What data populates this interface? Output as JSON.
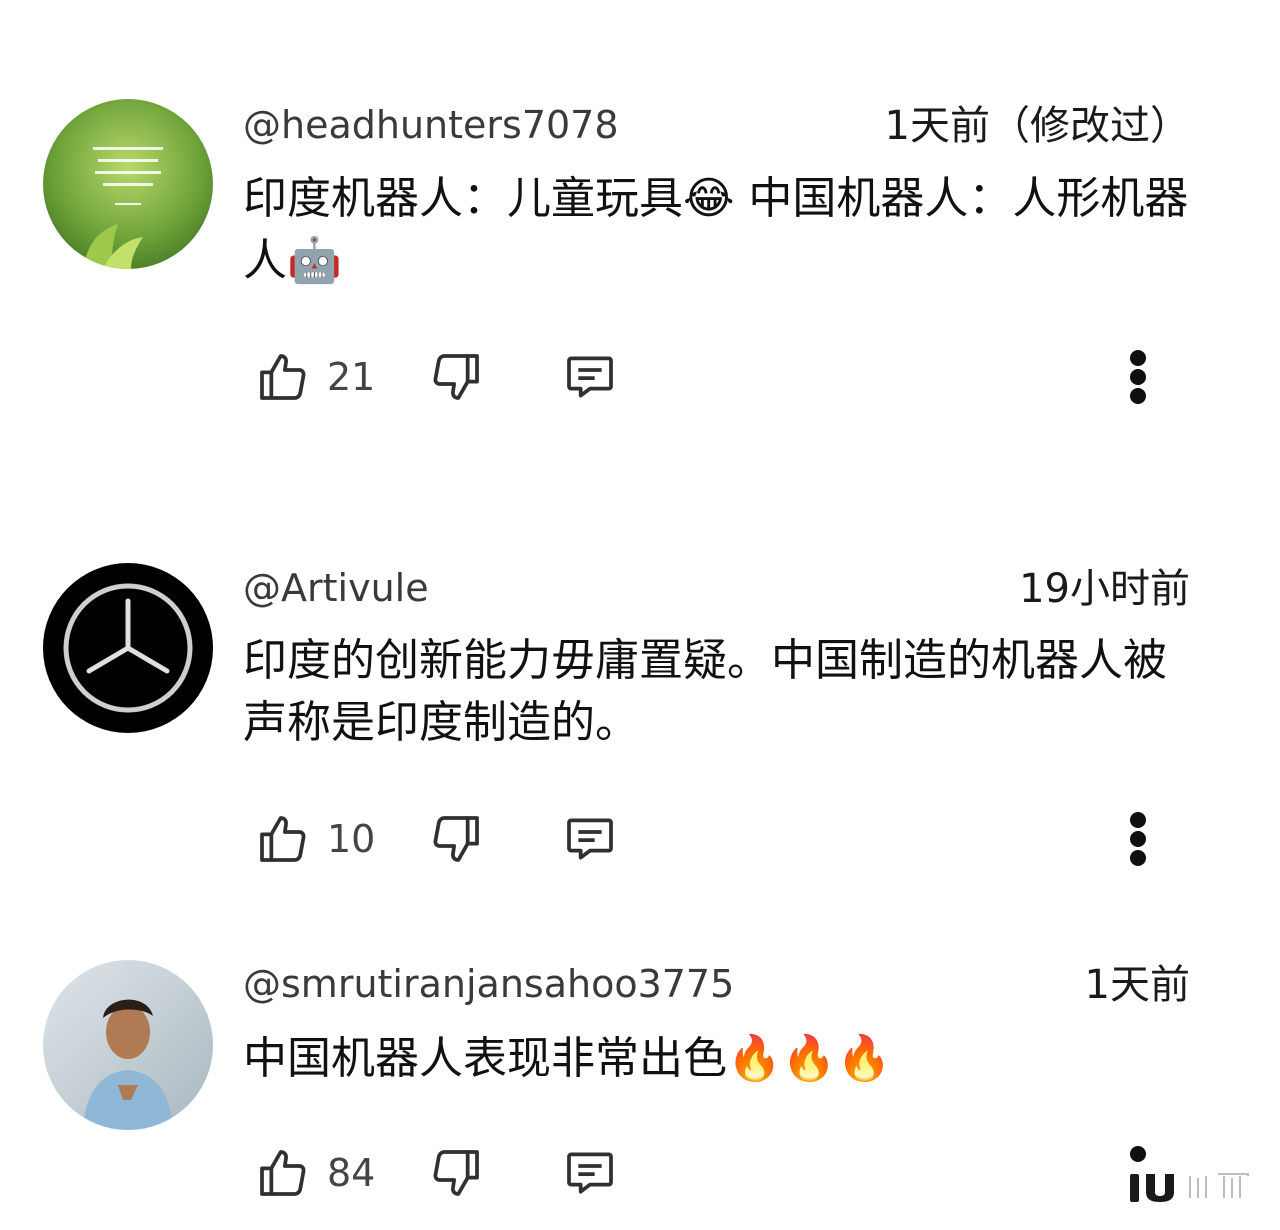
{
  "comments": [
    {
      "handle": "@headhunters7078",
      "time": "1天前（修改过）",
      "text": "印度机器人：儿童玩具😂 中国机器人：人形机器人🤖",
      "likes": "21",
      "avatar": "green-leaf-quote-avatar"
    },
    {
      "handle": "@Artivule",
      "time": "19小时前",
      "text": "印度的创新能力毋庸置疑。中国制造的机器人被声称是印度制造的。",
      "likes": "10",
      "avatar": "three-pointed-star-avatar"
    },
    {
      "handle": "@smrutiranjansahoo3775",
      "time": "1天前",
      "text": "中国机器人表现非常出色🔥🔥🔥",
      "likes": "84",
      "avatar": "person-photo-avatar"
    }
  ],
  "icons": {
    "like": "thumbs-up-icon",
    "dislike": "thumbs-down-icon",
    "reply": "reply-comment-icon",
    "more": "more-vertical-icon"
  },
  "colors": {
    "text": "#0f0f0f",
    "handle": "#3a3a3a",
    "icon": "#303030"
  }
}
